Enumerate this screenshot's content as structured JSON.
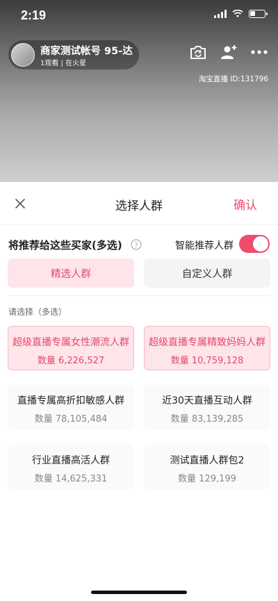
{
  "status": {
    "time": "2:19"
  },
  "live": {
    "anchor_name": "商家测试帐号 95-达",
    "anchor_sub": "1观看 | 在火星",
    "live_id": "淘宝直播 ID:131796"
  },
  "sheet": {
    "title": "选择人群",
    "confirm_label": "确认",
    "recommend_title": "将推荐给这些买家(多选)",
    "smart_label": "智能推荐人群",
    "tabs": [
      {
        "label": "精选人群",
        "active": true
      },
      {
        "label": "自定义人群",
        "active": false
      }
    ],
    "hint": "请选择（多选）",
    "cards": [
      {
        "name": "超级直播专属女性潮流人群",
        "count": "数量 6,226,527",
        "selected": true
      },
      {
        "name": "超级直播专属精致妈妈人群",
        "count": "数量 10,759,128",
        "selected": true
      },
      {
        "name": "直播专属高折扣敏感人群",
        "count": "数量 78,105,484",
        "selected": false
      },
      {
        "name": "近30天直播互动人群",
        "count": "数量 83,139,285",
        "selected": false
      },
      {
        "name": "行业直播高活人群",
        "count": "数量 14,625,331",
        "selected": false
      },
      {
        "name": "测试直播人群包2",
        "count": "数量 129,199",
        "selected": false
      }
    ]
  },
  "colors": {
    "accent": "#ee4d6e",
    "accent_bg": "#fde5ea"
  },
  "icons": [
    "signal-icon",
    "wifi-icon",
    "battery-icon",
    "camera-switch-icon",
    "add-user-icon",
    "more-icon",
    "close-icon",
    "help-icon"
  ]
}
